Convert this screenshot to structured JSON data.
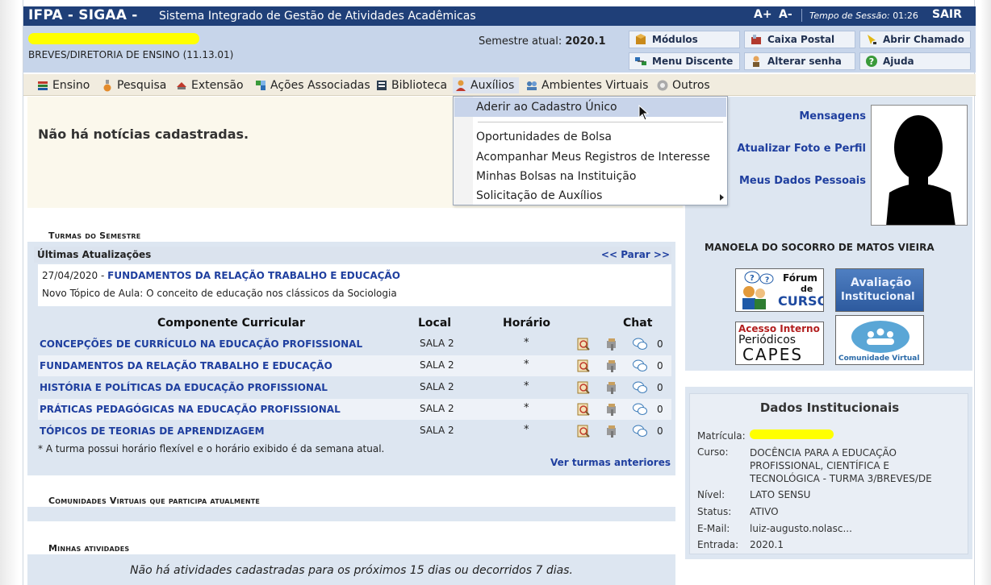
{
  "topbar": {
    "app_name": "IFPA - SIGAA -",
    "app_desc": "Sistema Integrado de Gestão de Atividades Acadêmicas",
    "font_up": "A+",
    "font_down": "A-",
    "session_label": "Tempo de Sessão: ",
    "session_time": "01:26",
    "logout": "SAIR"
  },
  "infobar": {
    "unit": "BREVES/DIRETORIA DE ENSINO (11.13.01)",
    "semester_label": "Semestre atual: ",
    "semester_value": "2020.1",
    "buttons": [
      {
        "label": "Módulos",
        "icon": "modules-icon"
      },
      {
        "label": "Caixa Postal",
        "icon": "mailbox-icon"
      },
      {
        "label": "Abrir Chamado",
        "icon": "ticket-icon"
      },
      {
        "label": "Menu Discente",
        "icon": "student-menu-icon"
      },
      {
        "label": "Alterar senha",
        "icon": "password-icon"
      },
      {
        "label": "Ajuda",
        "icon": "help-icon"
      }
    ]
  },
  "menu": {
    "items": [
      {
        "label": "Ensino",
        "icon": "books-icon"
      },
      {
        "label": "Pesquisa",
        "icon": "flask-icon"
      },
      {
        "label": "Extensão",
        "icon": "extension-icon"
      },
      {
        "label": "Ações Associadas",
        "icon": "puzzle-icon"
      },
      {
        "label": "Biblioteca",
        "icon": "library-icon"
      },
      {
        "label": "Auxílios",
        "icon": "user-aid-icon"
      },
      {
        "label": "Ambientes Virtuais",
        "icon": "virtual-env-icon"
      },
      {
        "label": "Outros",
        "icon": "others-icon"
      }
    ]
  },
  "dropdown": {
    "items": [
      "Aderir ao Cadastro Único",
      "Oportunidades de Bolsa",
      "Acompanhar Meus Registros de Interesse",
      "Minhas Bolsas na Instituição",
      "Solicitação de Auxílios"
    ]
  },
  "news": {
    "empty": "Não há notícias cadastradas."
  },
  "profile": {
    "links": [
      "Mensagens",
      "Atualizar Foto e Perfil",
      "Meus Dados Pessoais"
    ],
    "name": "MANOELA DO SOCORRO DE MATOS VIEIRA"
  },
  "banners": {
    "forum_line1": "Fórum",
    "forum_line2": "de",
    "forum_line3": "CURSO",
    "avaliacao_line1": "Avaliação",
    "avaliacao_line2": "Institucional",
    "capes_line1": "Acesso Interno",
    "capes_line2": "Periódicos",
    "capes_line3": "CAPES",
    "comunidade": "Comunidade Virtual"
  },
  "institutional": {
    "title": "Dados Institucionais",
    "rows": [
      {
        "label": "Matrícula:",
        "value": ""
      },
      {
        "label": "Curso:",
        "value": "DOCÊNCIA PARA A EDUCAÇÃO PROFISSIONAL, CIENTÍFICA E TECNOLÓGICA - TURMA 3/BREVES/DE"
      },
      {
        "label": "Nível:",
        "value": "LATO SENSU"
      },
      {
        "label": "Status:",
        "value": "ATIVO"
      },
      {
        "label": "E-Mail:",
        "value": "luiz-augusto.nolasc..."
      },
      {
        "label": "Entrada:",
        "value": "2020.1"
      }
    ]
  },
  "turmas": {
    "section_title": "Turmas do Semestre",
    "updates_label": "Últimas Atualizações",
    "stop_label": "<< Parar >>",
    "update_date": "27/04/2020 - ",
    "update_course": "FUNDAMENTOS DA RELAÇÃO TRABALHO E EDUCAÇÃO",
    "update_text": "Novo Tópico de Aula: O conceito de educação nos clássicos da Sociologia",
    "headers": {
      "component": "Componente Curricular",
      "local": "Local",
      "horario": "Horário",
      "chat": "Chat"
    },
    "rows": [
      {
        "name": "CONCEPÇÕES DE CURRÍCULO NA EDUCAÇÃO PROFISSIONAL",
        "local": "SALA 2",
        "horario": "*",
        "chat": "0"
      },
      {
        "name": "FUNDAMENTOS DA RELAÇÃO TRABALHO E EDUCAÇÃO",
        "local": "SALA 2",
        "horario": "*",
        "chat": "0"
      },
      {
        "name": "HISTÓRIA E POLÍTICAS DA EDUCAÇÃO PROFISSIONAL",
        "local": "SALA 2",
        "horario": "*",
        "chat": "0"
      },
      {
        "name": "PRÁTICAS PEDAGÓGICAS NA EDUCAÇÃO PROFISSIONAL",
        "local": "SALA 2",
        "horario": "*",
        "chat": "0"
      },
      {
        "name": "TÓPICOS DE TEORIAS DE APRENDIZAGEM",
        "local": "SALA 2",
        "horario": "*",
        "chat": "0"
      }
    ],
    "footnote": "* A turma possui horário flexível e o horário exibido é da semana atual.",
    "previous": "Ver turmas anteriores"
  },
  "communities": {
    "section_title": "Comunidades Virtuais que participa atualmente"
  },
  "activities": {
    "section_title": "Minhas atividades",
    "empty": "Não há atividades cadastradas para os próximos 15 dias ou decorridos 7 dias."
  }
}
